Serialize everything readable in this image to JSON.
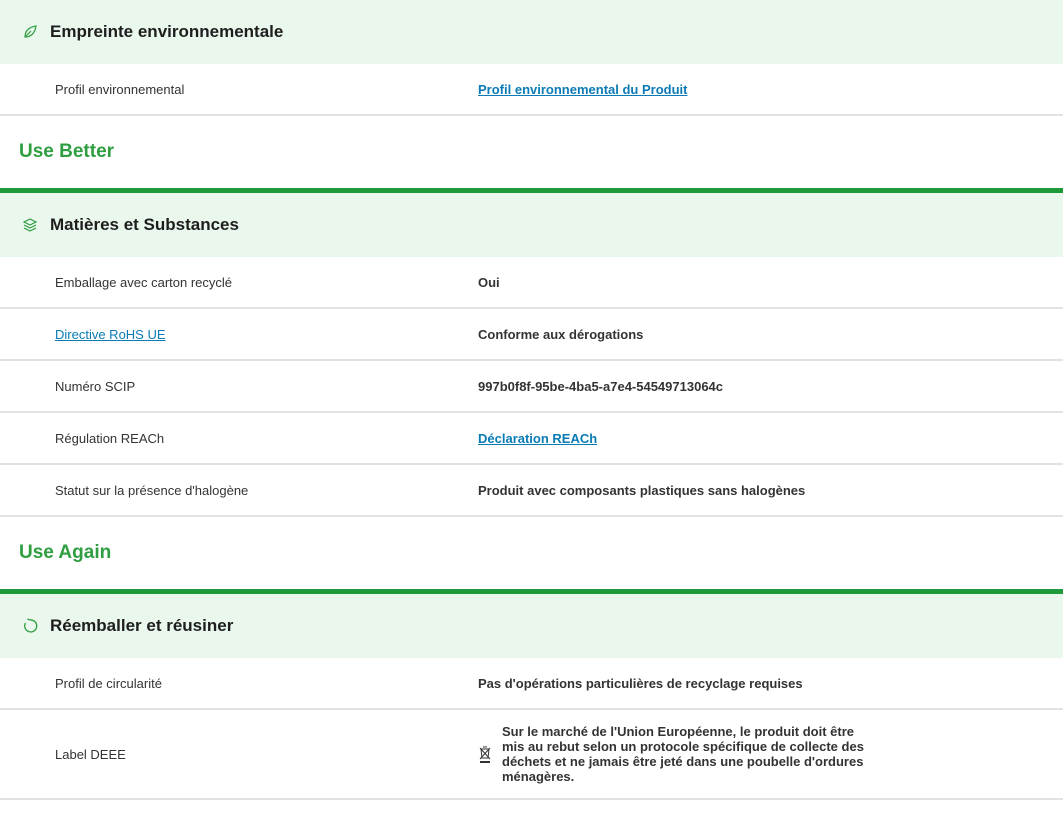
{
  "sections": {
    "env": {
      "title": "Empreinte environnementale",
      "rows": [
        {
          "label": "Profil environnemental",
          "value": "Profil environnemental du Produit"
        }
      ]
    },
    "use_better": {
      "group_title": "Use Better",
      "title": "Matières et Substances",
      "rows": [
        {
          "label": "Emballage avec carton recyclé",
          "value": "Oui"
        },
        {
          "label": "Directive RoHS UE",
          "value": "Conforme aux dérogations"
        },
        {
          "label": "Numéro SCIP",
          "value": "997b0f8f-95be-4ba5-a7e4-54549713064c"
        },
        {
          "label": "Régulation REACh",
          "value": "Déclaration REACh"
        },
        {
          "label": "Statut sur la présence d'halogène",
          "value": "Produit avec composants plastiques sans halogènes"
        }
      ]
    },
    "use_again": {
      "group_title": "Use Again",
      "title": "Réemballer et réusiner",
      "rows": [
        {
          "label": "Profil de circularité",
          "value": "Pas d'opérations particulières de recyclage requises"
        },
        {
          "label": "Label DEEE",
          "value": "Sur le marché de l'Union Européenne, le produit doit être mis au rebut selon un protocole spécifique de collecte des déchets et ne jamais être jeté dans une poubelle d'ordures ménagères."
        }
      ]
    }
  },
  "icons": {
    "env": "leaf-icon",
    "use_better": "layers-icon",
    "use_again": "refresh-icon",
    "weee": "crossed-bin-icon"
  },
  "colors": {
    "header_bg": "#e9f7ec",
    "green": "#2f9e41",
    "bar": "#1f9a3a",
    "link": "#0a7bb5"
  }
}
